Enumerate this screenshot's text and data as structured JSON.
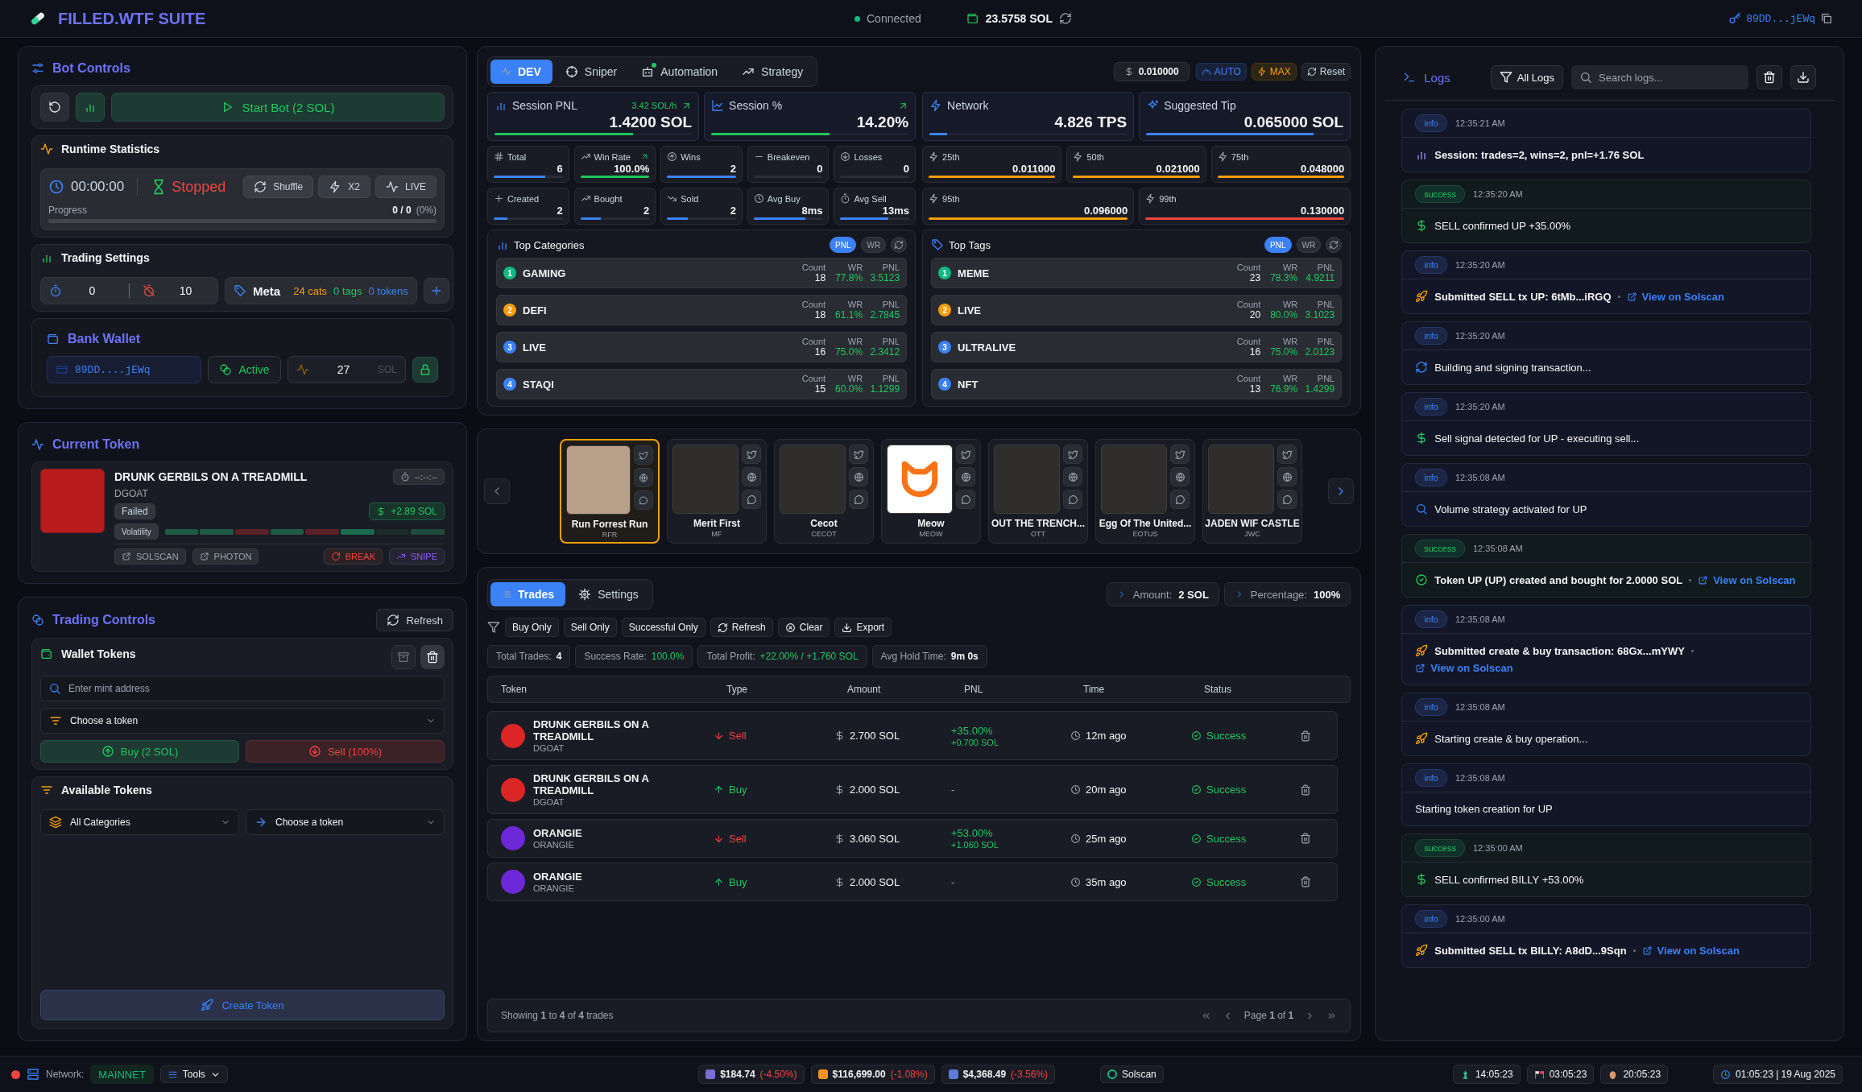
{
  "header": {
    "title": "FILLED.WTF SUITE",
    "status": "Connected",
    "connected": true,
    "balance": "23.5758 SOL",
    "wallet": "89DD...jEWq"
  },
  "bot_controls": {
    "title": "Bot Controls",
    "start_button": "Start Bot (2 SOL)",
    "runtime": {
      "title": "Runtime Statistics",
      "timer": "00:00:00",
      "state": "Stopped",
      "running": false,
      "buttons": [
        "Shuffle",
        "X2",
        "LIVE"
      ],
      "progress_label": "Progress",
      "progress_count": "0 / 0",
      "progress_percent": "(0%)",
      "level": 0
    },
    "trading_settings": {
      "title": "Trading Settings",
      "min": "0",
      "max": "10",
      "meta_label": "Meta",
      "cats": "24 cats",
      "tags": "0 tags",
      "tokens": "0 tokens"
    },
    "bank_wallet": {
      "title": "Bank Wallet",
      "address": "89DD....jEWq",
      "status": "Active",
      "amount": "27",
      "unit": "SOL"
    }
  },
  "current_token": {
    "title": "Current Token",
    "name": "DRUNK GERBILS ON A TREADMILL",
    "symbol": "DGOAT",
    "timer": "--:--:--",
    "status": "Failed",
    "pnl": "+2.89 SOL",
    "volatility_label": "Volatility",
    "volatility": [
      {
        "color": "#1f5a45"
      },
      {
        "color": "#1f5a45"
      },
      {
        "color": "#5a2128"
      },
      {
        "color": "#1f5a45"
      },
      {
        "color": "#5a2128"
      },
      {
        "color": "#1d6b4f"
      },
      {
        "color": "#1b2b27"
      },
      {
        "color": "#1f4a3c"
      }
    ],
    "links": [
      "SOLSCAN",
      "PHOTON"
    ],
    "break_button": "BREAK",
    "snipe_button": "SNIPE"
  },
  "trading_controls": {
    "title": "Trading Controls",
    "refresh": "Refresh",
    "wallet_tokens": {
      "title": "Wallet Tokens",
      "mint_placeholder": "Enter mint address",
      "token_select": "Choose a token",
      "buy": "Buy (2 SOL)",
      "sell": "Sell (100%)"
    },
    "available_tokens": {
      "title": "Available Tokens",
      "category_select": "All Categories",
      "token_select": "Choose a token"
    },
    "create_button": "Create Token"
  },
  "mode_tabs": [
    {
      "label": "DEV",
      "selected": true,
      "notification": false
    },
    {
      "label": "Sniper",
      "selected": false,
      "notification": false
    },
    {
      "label": "Automation",
      "selected": false,
      "notification": true
    },
    {
      "label": "Strategy",
      "selected": false,
      "notification": false
    }
  ],
  "tip_controls": {
    "value": "0.010000",
    "auto": "AUTO",
    "max": "MAX",
    "reset": "Reset"
  },
  "session_cards": [
    {
      "label": "Session PNL",
      "rate": "3.42 SOL/h",
      "value": "1.4200 SOL",
      "level": 0.7,
      "color": "#22c55e"
    },
    {
      "label": "Session %",
      "value": "14.20%",
      "level": 0.6,
      "color": "#22c55e"
    },
    {
      "label": "Network",
      "value": "4.826 TPS",
      "level": 0.09,
      "color": "#3b82f6"
    },
    {
      "label": "Suggested Tip",
      "value": "0.065000 SOL",
      "level": 0.85,
      "color": "#3b82f6"
    }
  ],
  "stats": [
    {
      "label": "Total",
      "value": "6",
      "level": 0.75,
      "color": "#3b82f6"
    },
    {
      "label": "Win Rate",
      "value": "100.0%",
      "level": 1,
      "color": "#22c55e"
    },
    {
      "label": "Wins",
      "value": "2",
      "level": 1,
      "color": "#3b82f6"
    },
    {
      "label": "Breakeven",
      "value": "0",
      "level": 0
    },
    {
      "label": "Losses",
      "value": "0",
      "level": 0
    },
    {
      "label": "Created",
      "value": "2",
      "level": 0.2,
      "color": "#3b82f6"
    },
    {
      "label": "Bought",
      "value": "2",
      "level": 0.3,
      "color": "#3b82f6"
    },
    {
      "label": "Sold",
      "value": "2",
      "level": 0.3,
      "color": "#3b82f6"
    },
    {
      "label": "Avg Buy",
      "value": "8ms",
      "level": 0.75,
      "color": "#3b82f6"
    },
    {
      "label": "Avg Sell",
      "value": "13ms",
      "level": 0.7,
      "color": "#3b82f6"
    }
  ],
  "percentiles": [
    {
      "label": "25th",
      "value": "0.011000",
      "level": 1,
      "color": "#f59e0b"
    },
    {
      "label": "50th",
      "value": "0.021000",
      "level": 1,
      "color": "#f59e0b"
    },
    {
      "label": "75th",
      "value": "0.048000",
      "level": 1,
      "color": "#f59e0b"
    },
    {
      "label": "95th",
      "value": "0.096000",
      "level": 1,
      "color": "#f59e0b"
    },
    {
      "label": "99th",
      "value": "0.130000",
      "level": 1,
      "color": "#ef4444"
    }
  ],
  "rankings": [
    {
      "title": "Top Categories",
      "toggles": [
        {
          "label": "PNL",
          "selected": true
        },
        {
          "label": "WR",
          "selected": false
        }
      ],
      "items": [
        {
          "rank": "1",
          "name": "GAMING",
          "count_label": "Count",
          "count": "18",
          "wr_label": "WR",
          "wr": "77.8%",
          "pnl_label": "PNL",
          "pnl": "3.5123",
          "color": "#10b981"
        },
        {
          "rank": "2",
          "name": "DEFI",
          "count_label": "Count",
          "count": "18",
          "wr_label": "WR",
          "wr": "61.1%",
          "pnl_label": "PNL",
          "pnl": "2.7845",
          "color": "#f59e0b"
        },
        {
          "rank": "3",
          "name": "LIVE",
          "count_label": "Count",
          "count": "16",
          "wr_label": "WR",
          "wr": "75.0%",
          "pnl_label": "PNL",
          "pnl": "2.3412",
          "color": "#3b82f6"
        },
        {
          "rank": "4",
          "name": "STAQI",
          "count_label": "Count",
          "count": "15",
          "wr_label": "WR",
          "wr": "60.0%",
          "pnl_label": "PNL",
          "pnl": "1.1299",
          "color": "#3b82f6"
        }
      ]
    },
    {
      "title": "Top Tags",
      "toggles": [
        {
          "label": "PNL",
          "selected": true
        },
        {
          "label": "WR",
          "selected": false
        }
      ],
      "items": [
        {
          "rank": "1",
          "name": "MEME",
          "count_label": "Count",
          "count": "23",
          "wr_label": "WR",
          "wr": "78.3%",
          "pnl_label": "PNL",
          "pnl": "4.9211",
          "color": "#10b981"
        },
        {
          "rank": "2",
          "name": "LIVE",
          "count_label": "Count",
          "count": "20",
          "wr_label": "WR",
          "wr": "80.0%",
          "pnl_label": "PNL",
          "pnl": "3.1023",
          "color": "#f59e0b"
        },
        {
          "rank": "3",
          "name": "ULTRALIVE",
          "count_label": "Count",
          "count": "16",
          "wr_label": "WR",
          "wr": "75.0%",
          "pnl_label": "PNL",
          "pnl": "2.0123",
          "color": "#3b82f6"
        },
        {
          "rank": "4",
          "name": "NFT",
          "count_label": "Count",
          "count": "13",
          "wr_label": "WR",
          "wr": "76.9%",
          "pnl_label": "PNL",
          "pnl": "1.4299",
          "color": "#3b82f6"
        }
      ]
    }
  ],
  "carousel": [
    {
      "name": "Run Forrest Run",
      "symbol": "RFR",
      "kind": "photo",
      "selected": true
    },
    {
      "name": "Merit First",
      "symbol": "MF",
      "kind": "photo",
      "selected": false
    },
    {
      "name": "Cecot",
      "symbol": "CECOT",
      "kind": "photo",
      "selected": false
    },
    {
      "name": "Meow",
      "symbol": "MEOW",
      "kind": "logo",
      "selected": false
    },
    {
      "name": "OUT THE TRENCH...",
      "symbol": "OTT",
      "kind": "photo",
      "selected": false
    },
    {
      "name": "Egg Of The United...",
      "symbol": "EOTUS",
      "kind": "photo",
      "selected": false
    },
    {
      "name": "JADEN WIF CASTLE",
      "symbol": "JWC",
      "kind": "photo",
      "selected": false
    }
  ],
  "trades": {
    "tabs": [
      {
        "label": "Trades",
        "selected": true
      },
      {
        "label": "Settings",
        "selected": false
      }
    ],
    "amount_label": "Amount:",
    "amount": "2 SOL",
    "percentage_label": "Percentage:",
    "percentage": "100%",
    "filters": [
      "Buy Only",
      "Sell Only",
      "Successful Only",
      "Refresh",
      "Clear",
      "Export"
    ],
    "summary": [
      {
        "label": "Total Trades:",
        "value": "4",
        "kind": "plain"
      },
      {
        "label": "Success Rate:",
        "value": "100.0%",
        "kind": "positive"
      },
      {
        "label": "Total Profit:",
        "value": "+22.00% /  +1.760 SOL",
        "kind": "positive"
      },
      {
        "label": "Avg Hold Time:",
        "value": "9m 0s",
        "kind": "plain"
      }
    ],
    "columns": [
      "Token",
      "Type",
      "Amount",
      "PNL",
      "Time",
      "Status"
    ],
    "rows": [
      {
        "name": "DRUNK GERBILS ON A TREADMILL",
        "symbol": "DGOAT",
        "color": "#dc2626",
        "kind": "sell",
        "type": "Sell",
        "amount": "2.700 SOL",
        "pnl": "+35.00%",
        "pnl_amount": "+0.700 SOL",
        "time": "12m ago",
        "status": "Success"
      },
      {
        "name": "DRUNK GERBILS ON A TREADMILL",
        "symbol": "DGOAT",
        "color": "#dc2626",
        "kind": "buy",
        "type": "Buy",
        "amount": "2.000 SOL",
        "pnl": "-",
        "time": "20m ago",
        "status": "Success"
      },
      {
        "name": "ORANGIE",
        "symbol": "ORANGIE",
        "color": "#6d28d9",
        "kind": "sell",
        "type": "Sell",
        "amount": "3.060 SOL",
        "pnl": "+53.00%",
        "pnl_amount": "+1.060 SOL",
        "time": "25m ago",
        "status": "Success"
      },
      {
        "name": "ORANGIE",
        "symbol": "ORANGIE",
        "color": "#6d28d9",
        "kind": "buy",
        "type": "Buy",
        "amount": "2.000 SOL",
        "pnl": "-",
        "time": "35m ago",
        "status": "Success"
      }
    ],
    "showing": "Showing **1** to **4** of **4** trades",
    "page": "Page **1** of **1**"
  },
  "logs": {
    "title": "Logs",
    "filter": "All Logs",
    "search_placeholder": "Search logs...",
    "entries": [
      {
        "level": "info",
        "time": "12:35:21 AM",
        "message": "Session: trades=2, wins=2, pnl=+1.76 SOL",
        "emphasis": true
      },
      {
        "level": "success",
        "time": "12:35:20 AM",
        "message": "SELL confirmed UP +35.00%",
        "emphasis": false
      },
      {
        "level": "info",
        "time": "12:35:20 AM",
        "message": "Submitted SELL tx UP: 6tMb...iRGQ",
        "emphasis": true,
        "link": "View on Solscan"
      },
      {
        "level": "info",
        "time": "12:35:20 AM",
        "message": "Building and signing transaction...",
        "emphasis": false
      },
      {
        "level": "info",
        "time": "12:35:20 AM",
        "message": "Sell signal detected for UP - executing sell...",
        "emphasis": false
      },
      {
        "level": "info",
        "time": "12:35:08 AM",
        "message": "Volume strategy activated for UP",
        "emphasis": false
      },
      {
        "level": "success",
        "time": "12:35:08 AM",
        "message": "Token UP (UP) created and bought for 2.0000 SOL",
        "emphasis": true,
        "link": "View on Solscan"
      },
      {
        "level": "info",
        "time": "12:35:08 AM",
        "message": "Submitted create & buy transaction: 68Gx...mYWY",
        "emphasis": true,
        "link": "View on Solscan"
      },
      {
        "level": "info",
        "time": "12:35:08 AM",
        "message": "Starting create & buy operation...",
        "emphasis": false
      },
      {
        "level": "info",
        "time": "12:35:08 AM",
        "message": "Starting token creation for UP",
        "emphasis": false
      },
      {
        "level": "success",
        "time": "12:35:00 AM",
        "message": "SELL confirmed BILLY +53.00%",
        "emphasis": false
      },
      {
        "level": "info",
        "time": "12:35:00 AM",
        "message": "Submitted SELL tx BILLY: A8dD...9Sqn",
        "emphasis": true,
        "link": "View on Solscan"
      }
    ]
  },
  "status_bar": {
    "network_label": "Network:",
    "network": "MAINNET",
    "tools": "Tools",
    "prices": [
      {
        "price": "$184.74",
        "change": "(-4.50%)",
        "color": "#7c6cd6"
      },
      {
        "price": "$116,699.00",
        "change": "(-1.08%)",
        "color": "#f7931a"
      },
      {
        "price": "$4,368.49",
        "change": "(-3.56%)",
        "color": "#5b7bd5"
      }
    ],
    "explorer": "Solscan",
    "clocks": [
      "14:05:23",
      "03:05:23",
      "20:05:23"
    ],
    "datetime": "01:05:23 | 19 Aug 2025"
  }
}
